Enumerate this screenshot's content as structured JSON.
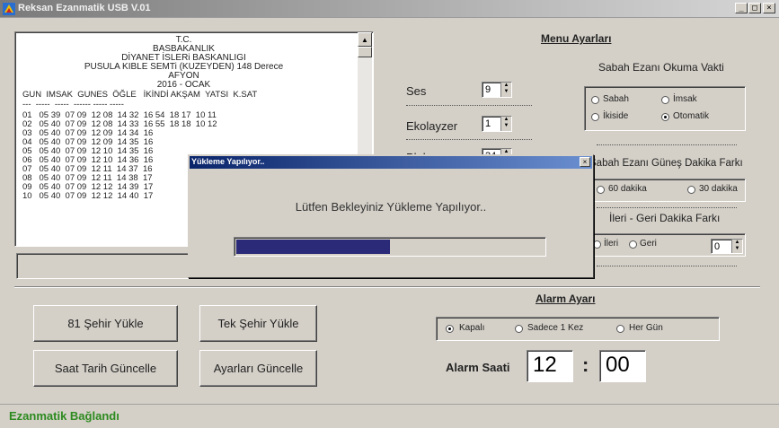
{
  "window": {
    "title": "Reksan Ezanmatik USB V.01",
    "minimize": "_",
    "maximize": "□",
    "close": "×"
  },
  "textbox": {
    "header": [
      "T.C.",
      "BASBAKANLIK",
      "DİYANET İSLERi BASKANLIGI",
      "PUSULA KIBLE SEMTi (KUZEYDEN) 148 Derece",
      "AFYON",
      "2016 - OCAK"
    ],
    "column_header": "GUN  IMSAK  GUNES  ÖĞLE   İKİNDİ AKŞAM  YATSI  K.SAT",
    "separator": "---  -----  -----  ------ ----- -----",
    "rows": [
      "01   05 39  07 09  12 08  14 32  16 54  18 17  10 11",
      "02   05 40  07 09  12 08  14 33  16 55  18 18  10 12",
      "03   05 40  07 09  12 09  14 34  16",
      "04   05 40  07 09  12 09  14 35  16",
      "05   05 40  07 09  12 10  14 35  16",
      "06   05 40  07 09  12 10  14 36  16",
      "07   05 40  07 09  12 11  14 37  16",
      "08   05 40  07 09  12 11  14 38  17",
      "09   05 40  07 09  12 12  14 39  17",
      "10   05 40  07 09  12 12  14 40  17"
    ]
  },
  "menu": {
    "title": "Menu Ayarları",
    "ses_label": "Ses",
    "ses_value": "9",
    "ekolayzer_label": "Ekolayzer",
    "ekolayzer_value": "1",
    "plaka_label": "Plaka",
    "plaka_value": "34",
    "sabah_title": "Sabah Ezanı Okuma Vakti",
    "sabah_options": [
      "Sabah",
      "İmsak",
      "İkiside",
      "Otomatik"
    ],
    "sabah_selected": "Otomatik",
    "gunes_title": "Sabah Ezanı Güneş Dakika Farkı",
    "gunes_options": [
      "60 dakika",
      "30 dakika"
    ],
    "ileri_title": "İleri - Geri Dakika Farkı",
    "ileri_options": [
      "İleri",
      "Geri"
    ],
    "ileri_value": "0"
  },
  "buttons": {
    "sehir81": "81 Şehir Yükle",
    "tek_sehir": "Tek Şehir Yükle",
    "saat_tarih": "Saat Tarih Güncelle",
    "ayarlari": "Ayarları Güncelle"
  },
  "alarm": {
    "title": "Alarm Ayarı",
    "options": [
      "Kapalı",
      "Sadece 1 Kez",
      "Her Gün"
    ],
    "selected": "Kapalı",
    "saat_label": "Alarm Saati",
    "hour": "12",
    "colon": ":",
    "minute": "00"
  },
  "dialog": {
    "title": "Yükleme Yapılıyor..",
    "message": "Lütfen Bekleyiniz Yükleme Yapılıyor..",
    "progress": 0.5
  },
  "status": "Ezanmatik Bağlandı",
  "colors": {
    "status_green": "#2d8a1f",
    "progress_fill": "#2b2a78",
    "dialog_title": "#0a246a"
  }
}
